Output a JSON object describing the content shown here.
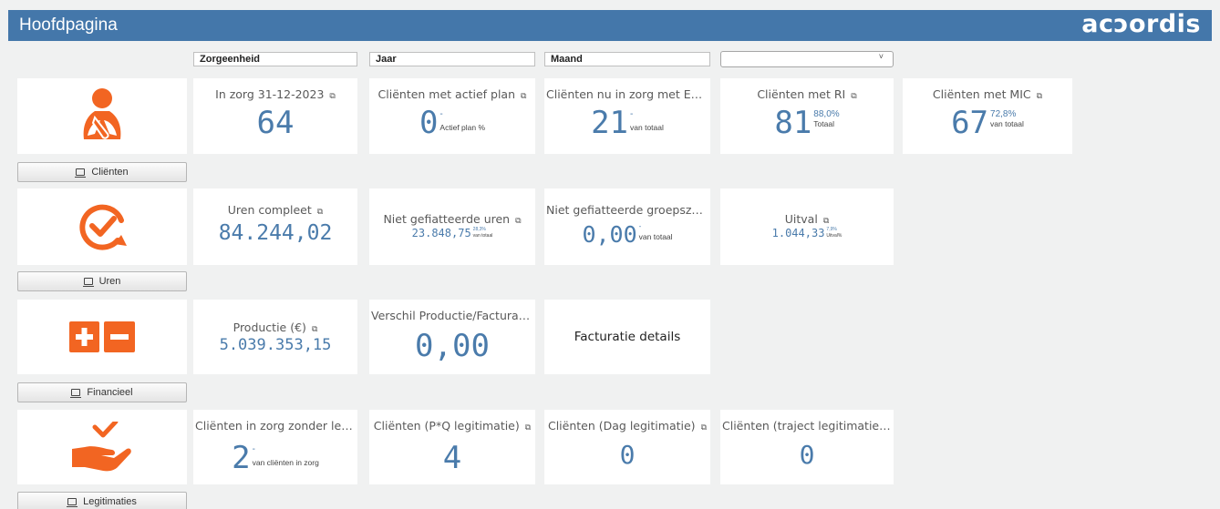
{
  "header": {
    "title": "Hoofdpagina",
    "logo": "acɔordis"
  },
  "filters": [
    {
      "label": "Zorgeenheid"
    },
    {
      "label": "Jaar"
    },
    {
      "label": "Maand"
    },
    {
      "label": "",
      "caret": "˅"
    }
  ],
  "sections": {
    "clienten": {
      "icon": "person-sling-icon",
      "button": "Cliënten",
      "kpis": [
        {
          "title": "In zorg 31-12-2023",
          "value": "64"
        },
        {
          "title": "Cliënten met actief plan",
          "value": "0",
          "pct": "-",
          "label": "Actief plan %"
        },
        {
          "title": "Cliënten nu in zorg met Evalua...",
          "value": "21",
          "pct": "-",
          "label": "van totaal"
        },
        {
          "title": "Cliënten met RI",
          "value": "81",
          "pct": "88,0%",
          "label": "Totaal"
        },
        {
          "title": "Cliënten met MIC",
          "value": "67",
          "pct": "72,8%",
          "label": "van totaal"
        }
      ]
    },
    "uren": {
      "icon": "clock-check-icon",
      "button": "Uren",
      "kpis": [
        {
          "title": "Uren compleet",
          "value": "84.244,02"
        },
        {
          "title": "Niet gefiatteerde uren",
          "value": "23.848,75",
          "pct": "28,3%",
          "label": "van totaal"
        },
        {
          "title": "Niet gefiatteerde groepszorg ...",
          "value": "0,00",
          "pct": "-",
          "label": "van totaal"
        },
        {
          "title": "Uitval",
          "value": "1.044,33",
          "pct": "7,9%",
          "label": "Uitval%"
        }
      ]
    },
    "financieel": {
      "icon": "plus-minus-icon",
      "button": "Financieel",
      "kpis": [
        {
          "title": "Productie (€)",
          "value": "5.039.353,15"
        },
        {
          "title": "Verschil Productie/Facturatie ...",
          "value": "0,00"
        }
      ],
      "text_card": "Facturatie details"
    },
    "legitimaties": {
      "icon": "hand-check-icon",
      "button": "Legitimaties",
      "kpis": [
        {
          "title": "Cliënten in zorg zonder legiti...",
          "value": "2",
          "pct": "-",
          "label": "van cliënten in zorg"
        },
        {
          "title": "Cliënten (P*Q legitimatie)",
          "value": "4"
        },
        {
          "title": "Cliënten (Dag legitimatie)",
          "value": "0"
        },
        {
          "title": "Cliënten (traject legitimatie)",
          "value": "0"
        }
      ]
    }
  },
  "colors": {
    "header": "#4477aa",
    "accent_orange": "#f26522",
    "kpi_blue": "#4a7bab",
    "background": "#f0f1f1"
  }
}
